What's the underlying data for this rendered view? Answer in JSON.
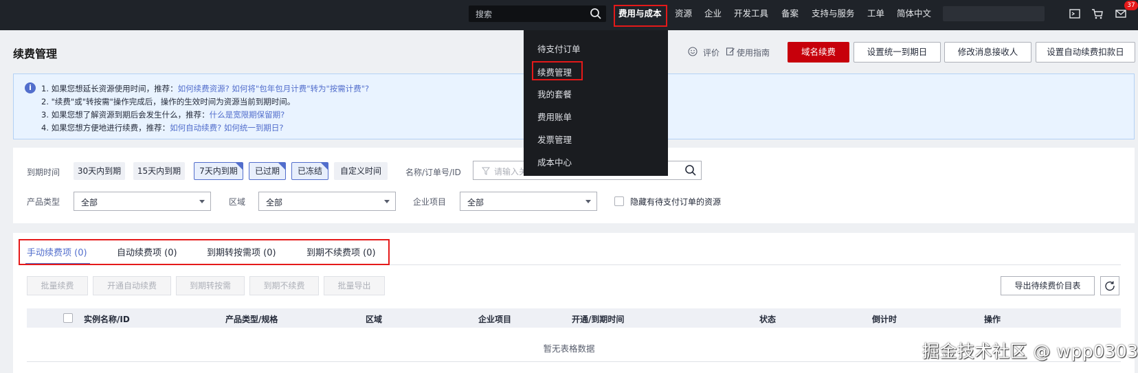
{
  "topbar": {
    "search_placeholder": "搜索",
    "nav": [
      "费用与成本",
      "资源",
      "企业",
      "开发工具",
      "备案",
      "支持与服务",
      "工单",
      "简体中文"
    ],
    "active_nav": "费用与成本",
    "message_badge": "37",
    "icons": [
      "search-icon",
      "console-icon",
      "cart-icon",
      "mail-icon"
    ]
  },
  "dropdown": {
    "items": [
      "待支付订单",
      "续费管理",
      "我的套餐",
      "费用账单",
      "发票管理",
      "成本中心"
    ],
    "highlighted": "续费管理"
  },
  "header": {
    "title": "续费管理",
    "feedback": "评价",
    "guide": "使用指南",
    "buttons": [
      "域名续费",
      "设置统一到期日",
      "修改消息接收人",
      "设置自动续费扣款日"
    ]
  },
  "info": {
    "lines": [
      {
        "text": "1. 如果您想延长资源使用时间，推荐：",
        "links": "如何续费资源?  如何将\"包年包月计费\"转为\"按需计费\"?"
      },
      {
        "text": "2. \"续费\"或\"转按需\"操作完成后，操作的生效时间为资源当前到期时间。",
        "links": ""
      },
      {
        "text": "3. 如果您想了解资源到期后会发生什么，推荐：",
        "links": "什么是宽限期保留期?"
      },
      {
        "text": "4. 如果您想方便地进行续费，推荐：",
        "links": "如何自动续费?  如何统一到期日?"
      }
    ]
  },
  "filters": {
    "expiry_label": "到期时间",
    "expiry_options": [
      "30天内到期",
      "15天内到期",
      "7天内到期",
      "已过期",
      "已冻结",
      "自定义时间"
    ],
    "selected_options": [
      "7天内到期",
      "已过期",
      "已冻结"
    ],
    "name_label": "名称/订单号/ID",
    "name_placeholder": "请输入关",
    "product_label": "产品类型",
    "product_value": "全部",
    "region_label": "区域",
    "region_value": "全部",
    "project_label": "企业项目",
    "project_value": "全部",
    "hide_pending_label": "隐藏有待支付订单的资源",
    "hide_pending_checked": false
  },
  "tabs": [
    {
      "label": "手动续费项 (0)",
      "active": true
    },
    {
      "label": "自动续费项 (0)",
      "active": false
    },
    {
      "label": "到期转按需项 (0)",
      "active": false
    },
    {
      "label": "到期不续费项 (0)",
      "active": false
    }
  ],
  "actions": {
    "disabled_buttons": [
      "批量续费",
      "开通自动续费",
      "到期转按需",
      "到期不续费",
      "批量导出"
    ],
    "export_label": "导出待续费价目表"
  },
  "table": {
    "columns": [
      "实例名称/ID",
      "产品类型/规格",
      "区域",
      "企业项目",
      "开通/到期时间",
      "状态",
      "倒计时",
      "操作"
    ],
    "empty_text": "暂无表格数据"
  },
  "watermark": "掘金技术社区 @ wpp0303",
  "colors": {
    "topbar_bg": "#1f2329",
    "primary_red": "#c7000b",
    "highlight_box": "#e51919",
    "link_blue": "#526ecc"
  }
}
